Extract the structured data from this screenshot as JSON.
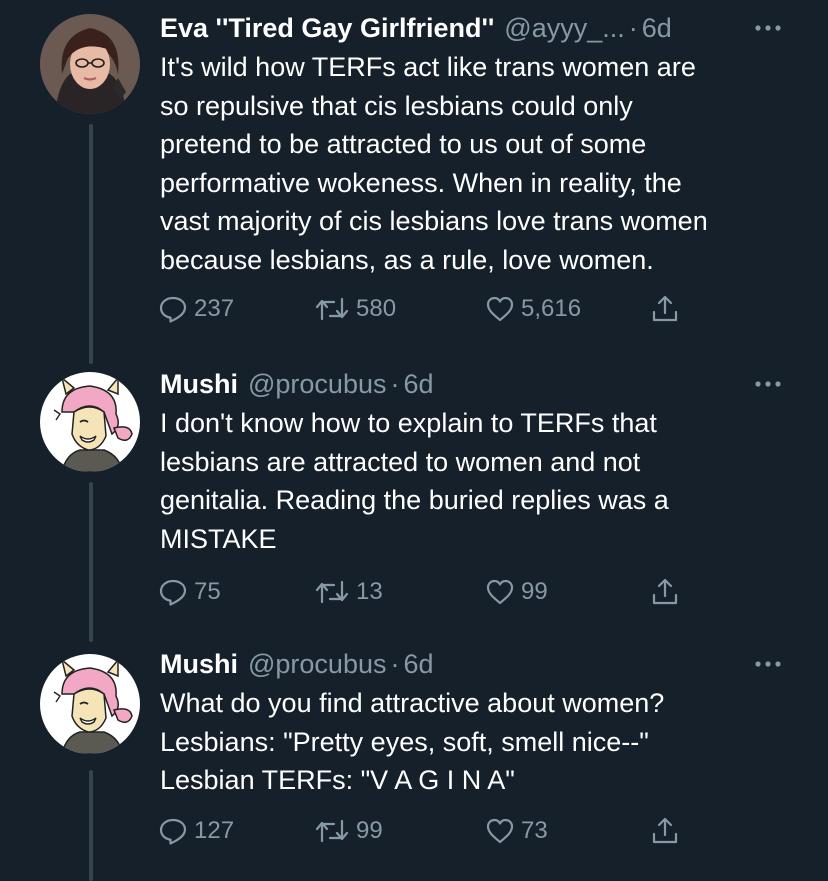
{
  "tweets": [
    {
      "name": "Eva ''Tired Gay Girlfriend''",
      "handle": "@ayyy_...",
      "dot": "·",
      "time": "6d",
      "lines": [
        "It's wild how TERFs act like trans women are",
        "so repulsive that cis lesbians could only",
        "pretend to be attracted to us out of some",
        "performative wokeness. When in reality, the",
        "vast majority of cis lesbians love trans women",
        "because lesbians, as a rule, love women."
      ],
      "replies": "237",
      "retweets": "580",
      "likes": "5,616"
    },
    {
      "name": "Mushi",
      "handle": "@procubus",
      "dot": "·",
      "time": "6d",
      "lines": [
        "I don't know how to explain to TERFs that",
        "lesbians are attracted to women and not",
        "genitalia. Reading the buried replies was a",
        "MISTAKE"
      ],
      "replies": "75",
      "retweets": "13",
      "likes": "99"
    },
    {
      "name": "Mushi",
      "handle": "@procubus",
      "dot": "·",
      "time": "6d",
      "lines": [
        "What do you find attractive about women?",
        "Lesbians: \"Pretty eyes, soft, smell nice--\"",
        "Lesbian TERFs: \"V A G I N A\""
      ],
      "replies": "127",
      "retweets": "99",
      "likes": "73"
    }
  ],
  "icons": {
    "reply": "reply-icon",
    "retweet": "retweet-icon",
    "like": "heart-icon",
    "share": "share-icon",
    "more": "more-icon"
  },
  "colors": {
    "background": "#15202b",
    "primary_text": "#ffffff",
    "secondary_text": "#8899a6",
    "thread_line": "#38444d"
  }
}
